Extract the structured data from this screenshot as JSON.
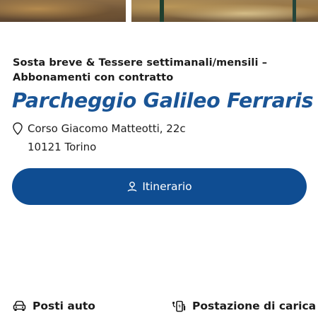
{
  "header": {
    "subtitle": "Sosta breve & Tessere settimanali/mensili – Abbonamenti con contratto",
    "title": "Parcheggio Galileo Ferraris"
  },
  "address": {
    "icon": "map-pin-icon",
    "street": "Corso Giacomo Matteotti, 22c",
    "city": "10121 Torino"
  },
  "route_button": {
    "icon": "route-pin-icon",
    "label": "Itinerario",
    "color": "#0f4d92"
  },
  "features": [
    {
      "icon": "car-icon",
      "label": "Posti auto"
    },
    {
      "icon": "charging-station-icon",
      "label": "Postazione di carica"
    }
  ],
  "colors": {
    "title": "#1a5596",
    "button": "#0f4d92",
    "text": "#1b1b1b"
  }
}
